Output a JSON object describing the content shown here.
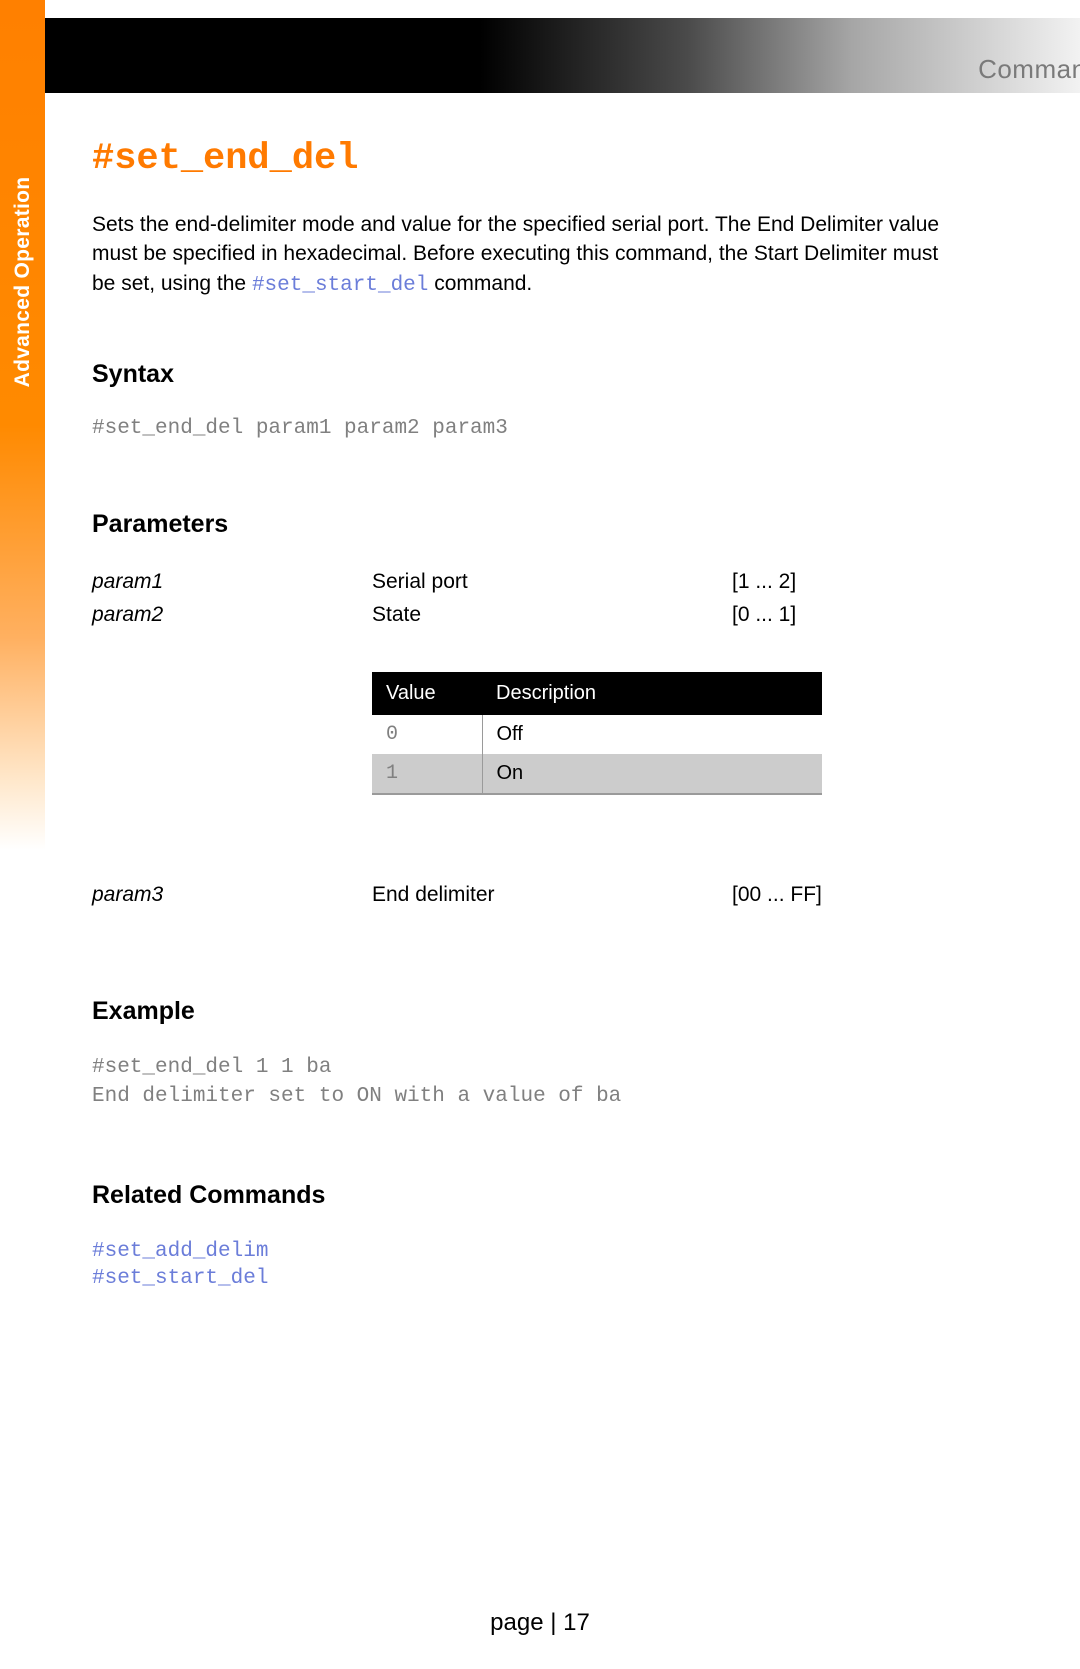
{
  "sidebar_label": "Advanced Operation",
  "header_section": "Commands",
  "command_title": "#set_end_del",
  "description_pre": "Sets the end-delimiter mode and value for the specified serial port. The End Delimiter value must be specified in hexadecimal. Before executing this command, the Start Delimiter must be set, using the ",
  "description_code": "#set_start_del",
  "description_post": " command.",
  "syntax_heading": "Syntax",
  "syntax_text": "#set_end_del param1 param2 param3",
  "parameters_heading": "Parameters",
  "params": [
    {
      "name": "param1",
      "desc": "Serial port",
      "range": "[1 ... 2]"
    },
    {
      "name": "param2",
      "desc": "State",
      "range": "[0 ... 1]"
    }
  ],
  "vd_header": {
    "value": "Value",
    "desc": "Description"
  },
  "vd_rows": [
    {
      "value": "0",
      "desc": "Off"
    },
    {
      "value": "1",
      "desc": "On"
    }
  ],
  "param3": {
    "name": "param3",
    "desc": "End delimiter",
    "range": "[00 ... FF]"
  },
  "example_heading": "Example",
  "example_text": "#set_end_del 1 1 ba\nEnd delimiter set to ON with a value of ba",
  "related_heading": "Related Commands",
  "related": [
    "#set_add_delim",
    "#set_start_del"
  ],
  "footer": "page | 17"
}
